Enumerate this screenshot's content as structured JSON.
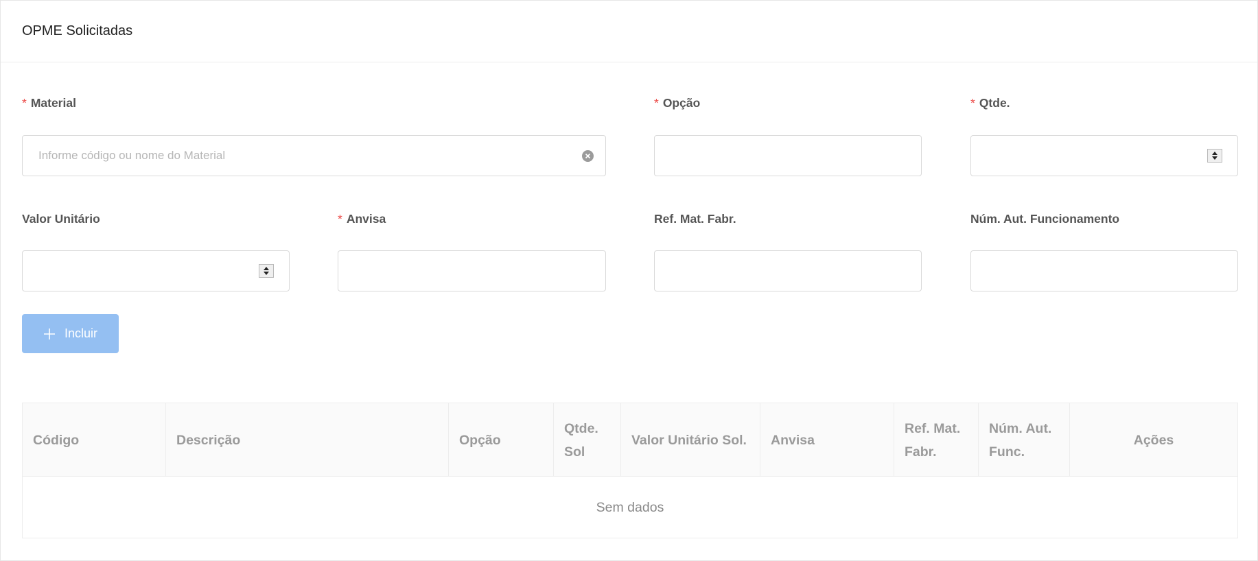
{
  "panel": {
    "title": "OPME Solicitadas"
  },
  "form": {
    "material": {
      "label": "Material",
      "required": "*",
      "placeholder": "Informe código ou nome do Material",
      "value": ""
    },
    "opcao": {
      "label": "Opção",
      "required": "*",
      "value": ""
    },
    "qtde": {
      "label": "Qtde.",
      "required": "*",
      "value": ""
    },
    "valor_unitario": {
      "label": "Valor Unitário",
      "value": ""
    },
    "anvisa": {
      "label": "Anvisa",
      "required": "*",
      "value": ""
    },
    "ref_mat_fabr": {
      "label": "Ref. Mat. Fabr.",
      "value": ""
    },
    "num_aut_funcionamento": {
      "label": "Núm. Aut. Funcionamento",
      "value": ""
    },
    "add_button": {
      "label": "Incluir",
      "icon": "plus-icon"
    }
  },
  "table": {
    "columns": [
      {
        "label": "Código"
      },
      {
        "label": "Descrição"
      },
      {
        "label": "Opção"
      },
      {
        "label": "Qtde. Sol"
      },
      {
        "label": "Valor Unitário Sol."
      },
      {
        "label": "Anvisa"
      },
      {
        "label": "Ref. Mat. Fabr."
      },
      {
        "label": "Núm. Aut. Func."
      },
      {
        "label": "Ações"
      }
    ],
    "rows": [],
    "empty_text": "Sem dados"
  },
  "colors": {
    "required_mark": "#ec4b48",
    "button_disabled_bg": "#94bff2",
    "header_text": "#9a9a9a"
  }
}
